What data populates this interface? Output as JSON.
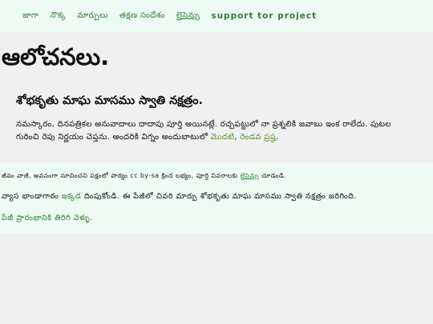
{
  "nav": {
    "items": [
      {
        "label": "జాగా"
      },
      {
        "label": "నొక్క"
      },
      {
        "label": "మార్పులు"
      },
      {
        "label": "తక్షణ సందేశం"
      },
      {
        "label": "లైసెన్సు"
      },
      {
        "label": "support tor project"
      }
    ]
  },
  "page": {
    "title": "ఆలోచనలు."
  },
  "post": {
    "title": "శోభకృతు మాఘ మాసము స్వాతి నక్షత్రం.",
    "body_part1": "నమస్కారం, దినపత్రికల అనువాదాలు దాదాపు పూర్తి అయినట్లే. రచ్చపట్టులో నా ప్రశ్నలికి జవాబు ఇంక రాలేదు. పుటల గురించి రెపు నిర్ణయం చెప్తను. అందరికి విగ్నం అందుబాటులో ",
    "link1": "మొదటి",
    "sep": ", ",
    "link2": "రెండవ",
    "body_part2": " ",
    "link3": "ప్రష్ఠ",
    "body_end": "."
  },
  "footer": {
    "line1_text": "జీవం వాజీ, అవసంగా సూచించని పక్షంలో పాఠ్యం cc by-sa క్రింద లభ్యం, పూర్తి వివరాలకు ",
    "line1_link": "లైసెన్సు",
    "line1_end": " చూడండి.",
    "line2_text": "వ్యాస భాండాగారం ",
    "line2_link": "ఇక్కడ",
    "line2_end": " దింపుకోండి. ఈ పేజీలో చివరి మార్పు శోభకృతు మాఘ మాసము స్వాతి నక్షత్రం జరిగింది.",
    "line3_link": "పేజీ ప్రారంభానికి తిరిగి వెళ్ళు."
  },
  "colors": {
    "link": "#2e7d32",
    "band": "#eefaf4",
    "background": "#f0f0f0"
  }
}
